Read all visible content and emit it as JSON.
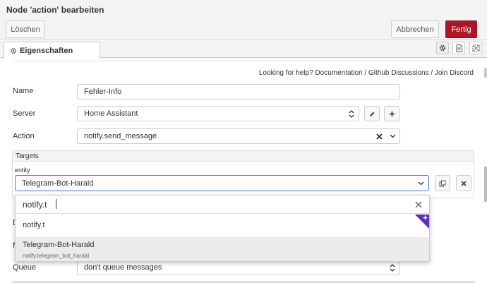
{
  "header": {
    "title": "Node 'action' bearbeiten",
    "delete_label": "Löschen",
    "cancel_label": "Abbrechen",
    "done_label": "Fertig"
  },
  "tabs": {
    "properties_label": "Eigenschaften",
    "icons": [
      "gear-icon",
      "description-icon",
      "appearance-icon"
    ]
  },
  "help": {
    "prefix": "Looking for help?",
    "documentation": "Documentation",
    "sep1": "/",
    "github": "Github Discussions",
    "sep2": "/",
    "discord": "Join Discord"
  },
  "form": {
    "name_label": "Name",
    "name_value": "Fehler-Info",
    "server_label": "Server",
    "server_value": "Home Assistant",
    "action_label": "Action",
    "action_value": "notify.send_message",
    "targets_label": "Targets",
    "entity_label": "entity",
    "entity_value": "Telegram-Bot-Harald",
    "queue_label": "Queue",
    "queue_value": "don't queue messages",
    "hidden_label_1": "D",
    "hidden_label_2": "M"
  },
  "dropdown": {
    "search_value": "notify.t",
    "options": [
      {
        "label": "notify.t",
        "sub": ""
      },
      {
        "label": "Telegram-Bot-Harald",
        "sub": "notify.telegram_bot_harald"
      }
    ]
  },
  "colors": {
    "accent_danger": "#ad1625",
    "focus_border": "#3b7ddd",
    "badge_purple": "#5b2fb5"
  }
}
